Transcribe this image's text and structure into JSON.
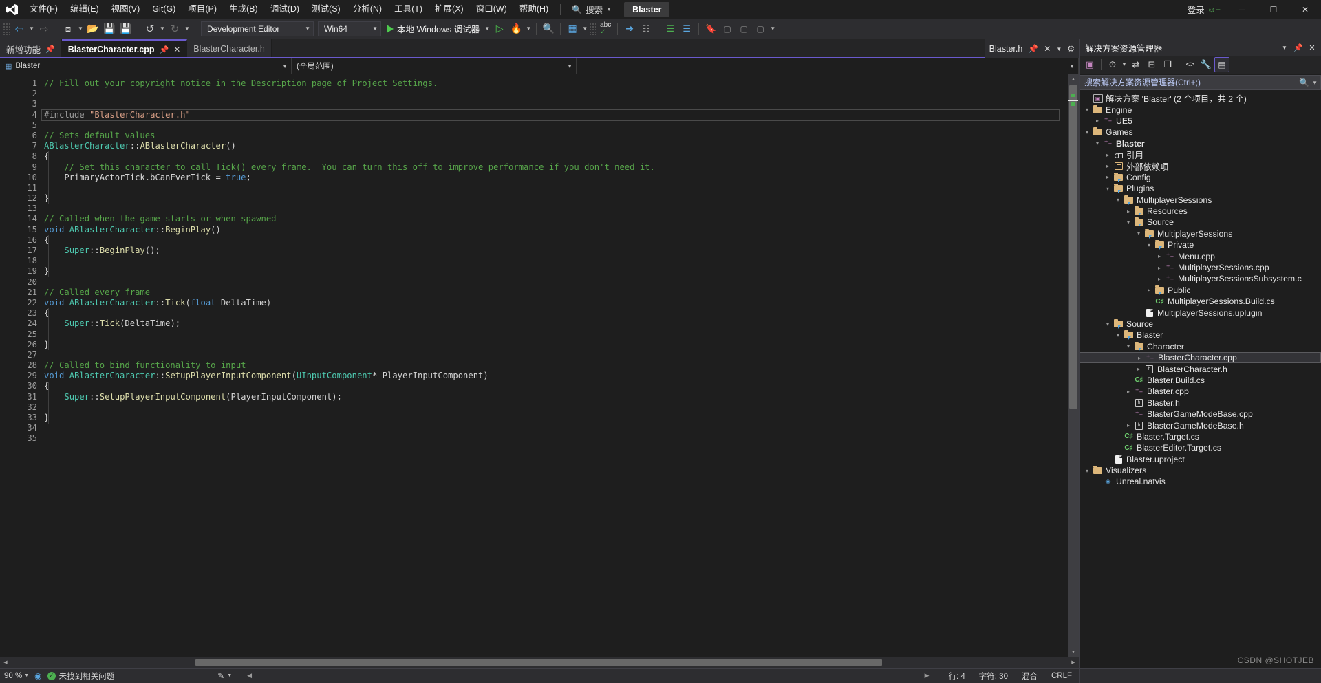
{
  "menubar": {
    "logo_icon": "visual-studio-logo",
    "items": [
      "文件(F)",
      "编辑(E)",
      "视图(V)",
      "Git(G)",
      "项目(P)",
      "生成(B)",
      "调试(D)",
      "测试(S)",
      "分析(N)",
      "工具(T)",
      "扩展(X)",
      "窗口(W)",
      "帮助(H)"
    ],
    "search_placeholder": "搜索",
    "search_icon": "search-icon",
    "project_badge": "Blaster",
    "signin_label": "登录",
    "signin_icon": "account-add-icon",
    "minimize_icon": "minimize-icon",
    "maximize_icon": "restore-icon",
    "close_icon": "close-icon"
  },
  "toolbar": {
    "nav_back_icon": "navigate-back-icon",
    "nav_forward_icon": "navigate-forward-icon",
    "new_item_icon": "new-item-icon",
    "open_file_icon": "open-file-icon",
    "save_icon": "save-icon",
    "save_all_icon": "save-all-icon",
    "undo_icon": "undo-icon",
    "redo_icon": "redo-icon",
    "configuration": "Development Editor",
    "platform": "Win64",
    "run_label": "本地 Windows 调试器",
    "run_icon": "play-icon",
    "start_no_debug_icon": "play-outline-icon",
    "hot_reload_icon": "hot-reload-icon",
    "find_in_files_icon": "find-in-files-icon",
    "window_layout_icon": "window-layout-icon",
    "spell_check_icon": "spell-check-abc-icon",
    "spell_check_label": "abc",
    "pointer_select_icon": "pointer-select-icon",
    "compare_icon": "compare-files-icon",
    "indent_icon": "indent-lines-icon",
    "comment_icon": "comment-lines-icon",
    "bookmark_icon": "bookmark-icon",
    "bookmark_prev_icon": "bookmark-prev-icon",
    "bookmark_next_icon": "bookmark-next-icon",
    "bookmark_clear_icon": "bookmark-clear-icon"
  },
  "tabs": {
    "start_page": {
      "label": "新增功能",
      "pin_icon": "pin-icon"
    },
    "open": [
      {
        "label": "BlasterCharacter.cpp",
        "active": true,
        "pin_icon": "pin-icon",
        "close_icon": "close-icon"
      },
      {
        "label": "BlasterCharacter.h",
        "active": false
      }
    ],
    "split_panel": {
      "label": "Blaster.h",
      "pin_icon": "pin-icon",
      "close_icon": "close-icon",
      "dropdown_icon": "chevron-down-icon",
      "settings_icon": "gear-icon"
    }
  },
  "navbar": {
    "project": "Blaster",
    "project_icon": "cpp-project-icon",
    "scope": "(全局范围)",
    "member": ""
  },
  "editor": {
    "accent_color": "#6a5acd",
    "lines": [
      {
        "n": 1,
        "tokens": [
          {
            "t": "// Fill out your copyright notice in the Description page of Project Settings.",
            "c": "c-comment"
          }
        ]
      },
      {
        "n": 2,
        "tokens": []
      },
      {
        "n": 3,
        "tokens": []
      },
      {
        "n": 4,
        "tokens": [
          {
            "t": "#include ",
            "c": "c-pp"
          },
          {
            "t": "\"BlasterCharacter.h\"",
            "c": "c-str"
          }
        ],
        "current": true,
        "changed": true
      },
      {
        "n": 5,
        "tokens": []
      },
      {
        "n": 6,
        "tokens": [
          {
            "t": "// Sets default values",
            "c": "c-comment"
          }
        ]
      },
      {
        "n": 7,
        "tokens": [
          {
            "t": "ABlasterCharacter",
            "c": "c-cls"
          },
          {
            "t": "::",
            "c": "c-plain"
          },
          {
            "t": "ABlasterCharacter",
            "c": "c-fn"
          },
          {
            "t": "()",
            "c": "c-plain"
          }
        ],
        "fold": true
      },
      {
        "n": 8,
        "tokens": [
          {
            "t": "{",
            "c": "c-plain"
          }
        ]
      },
      {
        "n": 9,
        "tokens": [
          {
            "t": "    // Set this character to call Tick() every frame.  You can turn this off to improve performance if you don't need it.",
            "c": "c-comment"
          }
        ]
      },
      {
        "n": 10,
        "tokens": [
          {
            "t": "    PrimaryActorTick",
            "c": "c-plain"
          },
          {
            "t": ".",
            "c": "c-plain"
          },
          {
            "t": "bCanEverTick ",
            "c": "c-plain"
          },
          {
            "t": "= ",
            "c": "c-plain"
          },
          {
            "t": "true",
            "c": "c-kw"
          },
          {
            "t": ";",
            "c": "c-plain"
          }
        ]
      },
      {
        "n": 11,
        "tokens": []
      },
      {
        "n": 12,
        "tokens": [
          {
            "t": "}",
            "c": "c-plain"
          }
        ]
      },
      {
        "n": 13,
        "tokens": []
      },
      {
        "n": 14,
        "tokens": [
          {
            "t": "// Called when the game starts or when spawned",
            "c": "c-comment"
          }
        ]
      },
      {
        "n": 15,
        "tokens": [
          {
            "t": "void ",
            "c": "c-kw"
          },
          {
            "t": "ABlasterCharacter",
            "c": "c-cls"
          },
          {
            "t": "::",
            "c": "c-plain"
          },
          {
            "t": "BeginPlay",
            "c": "c-fn"
          },
          {
            "t": "()",
            "c": "c-plain"
          }
        ],
        "fold": true
      },
      {
        "n": 16,
        "tokens": [
          {
            "t": "{",
            "c": "c-plain"
          }
        ]
      },
      {
        "n": 17,
        "tokens": [
          {
            "t": "    ",
            "c": "c-plain"
          },
          {
            "t": "Super",
            "c": "c-cls"
          },
          {
            "t": "::",
            "c": "c-plain"
          },
          {
            "t": "BeginPlay",
            "c": "c-fn"
          },
          {
            "t": "();",
            "c": "c-plain"
          }
        ]
      },
      {
        "n": 18,
        "tokens": []
      },
      {
        "n": 19,
        "tokens": [
          {
            "t": "}",
            "c": "c-plain"
          }
        ]
      },
      {
        "n": 20,
        "tokens": []
      },
      {
        "n": 21,
        "tokens": [
          {
            "t": "// Called every frame",
            "c": "c-comment"
          }
        ]
      },
      {
        "n": 22,
        "tokens": [
          {
            "t": "void ",
            "c": "c-kw"
          },
          {
            "t": "ABlasterCharacter",
            "c": "c-cls"
          },
          {
            "t": "::",
            "c": "c-plain"
          },
          {
            "t": "Tick",
            "c": "c-fn"
          },
          {
            "t": "(",
            "c": "c-plain"
          },
          {
            "t": "float",
            "c": "c-kw"
          },
          {
            "t": " DeltaTime)",
            "c": "c-plain"
          }
        ],
        "fold": true
      },
      {
        "n": 23,
        "tokens": [
          {
            "t": "{",
            "c": "c-plain"
          }
        ]
      },
      {
        "n": 24,
        "tokens": [
          {
            "t": "    ",
            "c": "c-plain"
          },
          {
            "t": "Super",
            "c": "c-cls"
          },
          {
            "t": "::",
            "c": "c-plain"
          },
          {
            "t": "Tick",
            "c": "c-fn"
          },
          {
            "t": "(DeltaTime);",
            "c": "c-plain"
          }
        ]
      },
      {
        "n": 25,
        "tokens": []
      },
      {
        "n": 26,
        "tokens": [
          {
            "t": "}",
            "c": "c-plain"
          }
        ]
      },
      {
        "n": 27,
        "tokens": []
      },
      {
        "n": 28,
        "tokens": [
          {
            "t": "// Called to bind functionality to input",
            "c": "c-comment"
          }
        ]
      },
      {
        "n": 29,
        "tokens": [
          {
            "t": "void ",
            "c": "c-kw"
          },
          {
            "t": "ABlasterCharacter",
            "c": "c-cls"
          },
          {
            "t": "::",
            "c": "c-plain"
          },
          {
            "t": "SetupPlayerInputComponent",
            "c": "c-fn"
          },
          {
            "t": "(",
            "c": "c-plain"
          },
          {
            "t": "UInputComponent",
            "c": "c-cls"
          },
          {
            "t": "* PlayerInputComponent)",
            "c": "c-plain"
          }
        ],
        "fold": true
      },
      {
        "n": 30,
        "tokens": [
          {
            "t": "{",
            "c": "c-plain"
          }
        ]
      },
      {
        "n": 31,
        "tokens": [
          {
            "t": "    ",
            "c": "c-plain"
          },
          {
            "t": "Super",
            "c": "c-cls"
          },
          {
            "t": "::",
            "c": "c-plain"
          },
          {
            "t": "SetupPlayerInputComponent",
            "c": "c-fn"
          },
          {
            "t": "(PlayerInputComponent);",
            "c": "c-plain"
          }
        ]
      },
      {
        "n": 32,
        "tokens": []
      },
      {
        "n": 33,
        "tokens": [
          {
            "t": "}",
            "c": "c-plain"
          }
        ]
      },
      {
        "n": 34,
        "tokens": []
      },
      {
        "n": 35,
        "tokens": []
      }
    ]
  },
  "statusbar": {
    "zoom": "90 %",
    "zoom_arrow_icon": "chevron-down-icon",
    "scope_icon": "scope-icon",
    "issue_icon": "check-circle-icon",
    "issue_text": "未找到相关问题",
    "source_control_icon": "source-control-icon",
    "source_control_arrow_icon": "chevron-down-icon",
    "line_label": "行: 4",
    "col_label": "字符: 30",
    "mode_label": "混合",
    "eol_label": "CRLF"
  },
  "solution_explorer": {
    "title": "解决方案资源管理器",
    "header_icons": {
      "dropdown": "chevron-down-icon",
      "pin": "pin-icon",
      "close": "close-icon"
    },
    "toolbar_icons": [
      "solution-explorer-home-icon",
      "pending-changes-icon",
      "pending-changes-dropdown-icon",
      "sync-with-active-document-icon",
      "collapse-all-icon",
      "properties-pages-icon",
      "show-all-files-icon",
      "properties-wrench-icon",
      "preview-selected-items-icon"
    ],
    "search_placeholder": "搜索解决方案资源管理器(Ctrl+;)",
    "search_icon": "search-icon",
    "search_dropdown_icon": "chevron-down-icon",
    "tree": [
      {
        "depth": 0,
        "twist": "",
        "icon": "ic-sln",
        "label": "解决方案 'Blaster' (2 个项目，共 2 个)"
      },
      {
        "depth": 0,
        "twist": "▾",
        "icon": "ic-folder",
        "label": "Engine"
      },
      {
        "depth": 1,
        "twist": "▸",
        "icon": "ic-cpp",
        "label": "UE5"
      },
      {
        "depth": 0,
        "twist": "▾",
        "icon": "ic-folder",
        "label": "Games"
      },
      {
        "depth": 1,
        "twist": "▾",
        "icon": "ic-cpp",
        "label": "Blaster",
        "bold": true
      },
      {
        "depth": 2,
        "twist": "▸",
        "icon": "ic-ref",
        "label": "引用"
      },
      {
        "depth": 2,
        "twist": "▸",
        "icon": "ic-extdep",
        "label": "外部依赖项"
      },
      {
        "depth": 2,
        "twist": "▸",
        "icon": "ic-folder-filter",
        "label": "Config"
      },
      {
        "depth": 2,
        "twist": "▾",
        "icon": "ic-folder-filter",
        "label": "Plugins"
      },
      {
        "depth": 3,
        "twist": "▾",
        "icon": "ic-folder-filter",
        "label": "MultiplayerSessions"
      },
      {
        "depth": 4,
        "twist": "▸",
        "icon": "ic-folder-filter",
        "label": "Resources"
      },
      {
        "depth": 4,
        "twist": "▾",
        "icon": "ic-folder-filter",
        "label": "Source"
      },
      {
        "depth": 5,
        "twist": "▾",
        "icon": "ic-folder-filter",
        "label": "MultiplayerSessions"
      },
      {
        "depth": 6,
        "twist": "▾",
        "icon": "ic-folder-filter",
        "label": "Private"
      },
      {
        "depth": 7,
        "twist": "▸",
        "icon": "ic-cpp",
        "label": "Menu.cpp"
      },
      {
        "depth": 7,
        "twist": "▸",
        "icon": "ic-cpp",
        "label": "MultiplayerSessions.cpp"
      },
      {
        "depth": 7,
        "twist": "▸",
        "icon": "ic-cpp",
        "label": "MultiplayerSessionsSubsystem.c"
      },
      {
        "depth": 6,
        "twist": "▸",
        "icon": "ic-folder-filter",
        "label": "Public"
      },
      {
        "depth": 6,
        "twist": "",
        "icon": "ic-cs",
        "label": "MultiplayerSessions.Build.cs"
      },
      {
        "depth": 5,
        "twist": "",
        "icon": "ic-doc",
        "label": "MultiplayerSessions.uplugin"
      },
      {
        "depth": 2,
        "twist": "▾",
        "icon": "ic-folder-filter",
        "label": "Source"
      },
      {
        "depth": 3,
        "twist": "▾",
        "icon": "ic-folder-filter",
        "label": "Blaster"
      },
      {
        "depth": 4,
        "twist": "▾",
        "icon": "ic-folder-filter",
        "label": "Character"
      },
      {
        "depth": 5,
        "twist": "▸",
        "icon": "ic-cpp",
        "label": "BlasterCharacter.cpp",
        "selected": true
      },
      {
        "depth": 5,
        "twist": "▸",
        "icon": "ic-h",
        "label": "BlasterCharacter.h"
      },
      {
        "depth": 4,
        "twist": "",
        "icon": "ic-cs",
        "label": "Blaster.Build.cs"
      },
      {
        "depth": 4,
        "twist": "▸",
        "icon": "ic-cpp",
        "label": "Blaster.cpp"
      },
      {
        "depth": 4,
        "twist": "",
        "icon": "ic-h",
        "label": "Blaster.h"
      },
      {
        "depth": 4,
        "twist": "",
        "icon": "ic-cpp",
        "label": "BlasterGameModeBase.cpp"
      },
      {
        "depth": 4,
        "twist": "▸",
        "icon": "ic-h",
        "label": "BlasterGameModeBase.h"
      },
      {
        "depth": 3,
        "twist": "",
        "icon": "ic-cs",
        "label": "Blaster.Target.cs"
      },
      {
        "depth": 3,
        "twist": "",
        "icon": "ic-cs",
        "label": "BlasterEditor.Target.cs"
      },
      {
        "depth": 2,
        "twist": "",
        "icon": "ic-doc",
        "label": "Blaster.uproject"
      },
      {
        "depth": 0,
        "twist": "▾",
        "icon": "ic-folder",
        "label": "Visualizers"
      },
      {
        "depth": 1,
        "twist": "",
        "icon": "ic-natvis",
        "label": "Unreal.natvis"
      }
    ]
  },
  "watermark": "CSDN @SHOTJEB"
}
